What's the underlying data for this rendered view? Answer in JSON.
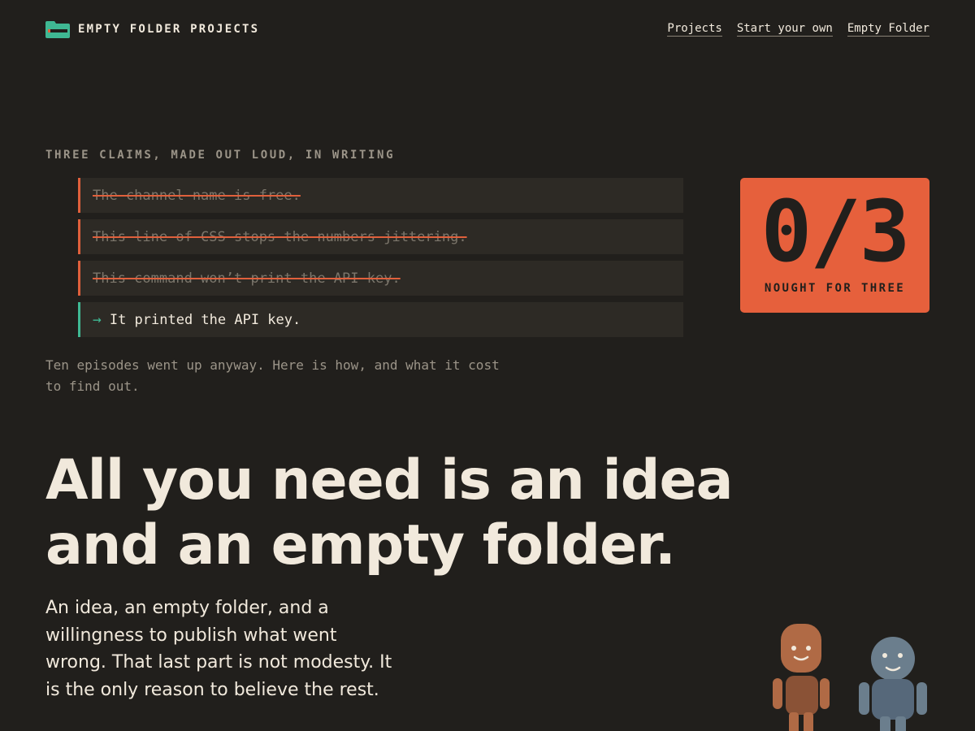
{
  "header": {
    "brand": "EMPTY FOLDER PROJECTS",
    "brand_icon": "folder-icon",
    "nav": [
      "Projects",
      "Start your own",
      "Empty Folder"
    ]
  },
  "claims_section": {
    "kicker": "THREE CLAIMS, MADE OUT LOUD, IN WRITING",
    "claims": [
      "The channel name is free.",
      "This line of CSS stops the numbers jittering.",
      "This command won’t print the API key."
    ],
    "truth": {
      "arrow": "→",
      "text": "It printed the API key."
    },
    "note": "Ten episodes went up anyway. Here is how, and what it cost to find out."
  },
  "score": {
    "value": "0/3",
    "label": "NOUGHT FOR THREE"
  },
  "hero": {
    "line1": "All you need is an idea",
    "line2": "and an empty folder.",
    "lede": "An idea, an empty folder, and a willingness to publish what went wrong. That last part is not modesty. It is the only reason to believe the rest."
  },
  "colors": {
    "background": "#211f1c",
    "accent_orange": "#e6603c",
    "accent_teal": "#3fb893",
    "text": "#f1e9dc",
    "muted": "#9b9488"
  }
}
